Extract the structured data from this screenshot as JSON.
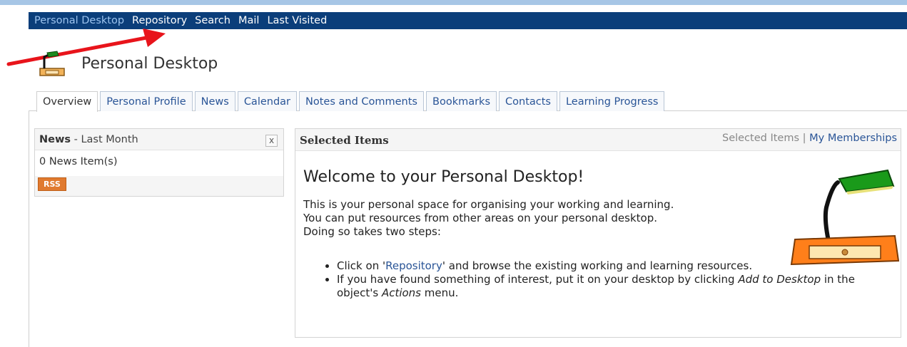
{
  "topnav": {
    "items": [
      {
        "label": "Personal Desktop",
        "active": true
      },
      {
        "label": "Repository",
        "active": false
      },
      {
        "label": "Search",
        "active": false
      },
      {
        "label": "Mail",
        "active": false
      },
      {
        "label": "Last Visited",
        "active": false
      }
    ]
  },
  "page": {
    "title": "Personal Desktop",
    "icon": "desk-lamp-icon"
  },
  "tabs": [
    {
      "label": "Overview",
      "active": true
    },
    {
      "label": "Personal Profile",
      "active": false
    },
    {
      "label": "News",
      "active": false
    },
    {
      "label": "Calendar",
      "active": false
    },
    {
      "label": "Notes and Comments",
      "active": false
    },
    {
      "label": "Bookmarks",
      "active": false
    },
    {
      "label": "Contacts",
      "active": false
    },
    {
      "label": "Learning Progress",
      "active": false
    }
  ],
  "news_block": {
    "title": "News",
    "subtitle": "- Last Month",
    "close": "x",
    "count_text": "0 News Item(s)",
    "rss": "RSS"
  },
  "selected_block": {
    "title": "Selected Items",
    "link_current": "Selected Items",
    "separator": " | ",
    "link_memberships": "My Memberships",
    "welcome": "Welcome to your Personal Desktop!",
    "intro_1": "This is your personal space for organising your working and learning.",
    "intro_2": "You can put resources from other areas on your personal desktop.",
    "intro_3": "Doing so takes two steps:",
    "step1_prefix": "Click on '",
    "step1_link": "Repository",
    "step1_suffix": "' and browse the existing working and learning resources.",
    "step2_prefix": "If you have found something of interest, put it on your desktop by clicking ",
    "step2_em1": "Add to Desktop",
    "step2_mid": " in the object's ",
    "step2_em2": "Actions",
    "step2_suffix": " menu."
  },
  "colors": {
    "topnav_bg": "#0b3e7a",
    "link": "#2a5597",
    "rss": "#e07a2f",
    "annotation_arrow": "#e8141b"
  }
}
